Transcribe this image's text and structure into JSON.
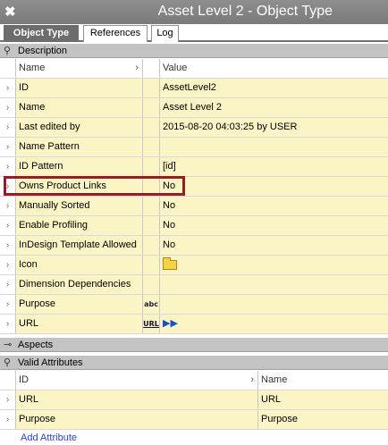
{
  "window": {
    "close_symbol": "✖",
    "title": "Asset Level 2 - Object Type"
  },
  "tabs": [
    {
      "label": "Object Type",
      "active": true
    },
    {
      "label": "References",
      "active": false
    },
    {
      "label": "Log",
      "active": false
    }
  ],
  "description": {
    "header": "Description",
    "columns": {
      "name": "Name",
      "value": "Value"
    },
    "rows": [
      {
        "name": "ID",
        "value": "AssetLevel2"
      },
      {
        "name": "Name",
        "value": "Asset Level 2"
      },
      {
        "name": "Last edited by",
        "value": "2015-08-20 04:03:25 by USER"
      },
      {
        "name": "Name Pattern",
        "value": ""
      },
      {
        "name": "ID Pattern",
        "value": "[id]"
      },
      {
        "name": "Owns Product Links",
        "value": "No"
      },
      {
        "name": "Manually Sorted",
        "value": "No"
      },
      {
        "name": "Enable Profiling",
        "value": "No"
      },
      {
        "name": "InDesign Template Allowed",
        "value": "No"
      },
      {
        "name": "Icon",
        "value": "",
        "icon": "folder-icon"
      },
      {
        "name": "Dimension Dependencies",
        "value": ""
      },
      {
        "name": "Purpose",
        "value": "",
        "mid_icon": "abc"
      },
      {
        "name": "URL",
        "value": "",
        "mid_icon": "URL",
        "value_icon": "▶▶"
      }
    ]
  },
  "aspects": {
    "header": "Aspects"
  },
  "valid_attributes": {
    "header": "Valid Attributes",
    "columns": {
      "id": "ID",
      "name": "Name"
    },
    "rows": [
      {
        "id": "URL",
        "name": "URL"
      },
      {
        "id": "Purpose",
        "name": "Purpose"
      }
    ],
    "add_link": "Add Attribute"
  },
  "colors": {
    "row_yellow": "#fbf5c6",
    "highlight": "#9a1b25",
    "title_bg": "#7a7a7a",
    "section_bg": "#c3c3c3"
  }
}
